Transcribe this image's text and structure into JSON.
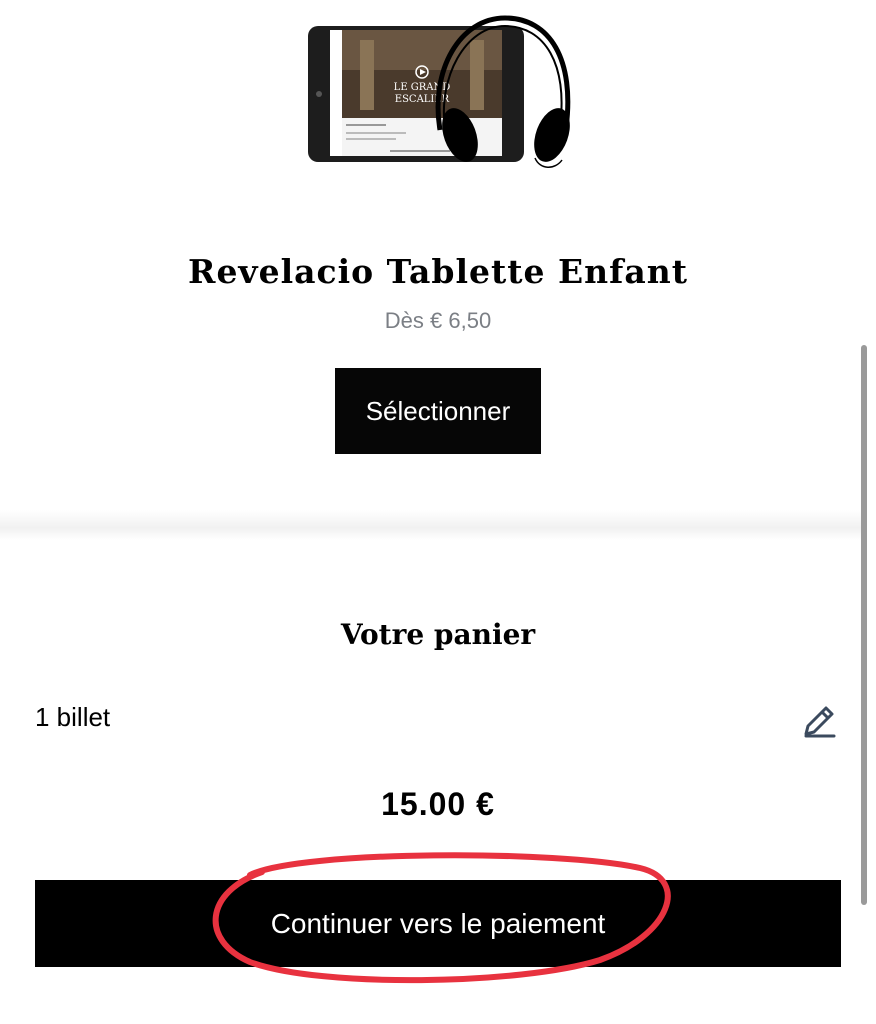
{
  "product": {
    "image_icon": "tablet-headphones-illustration",
    "screen_heading_line1": "LE GRAND",
    "screen_heading_line2": "ESCALIER",
    "title": "Revelacio Tablette Enfant",
    "price": "Dès € 6,50",
    "select_label": "Sélectionner"
  },
  "cart": {
    "title": "Votre panier",
    "count_label": "1 billet",
    "edit_icon": "pencil-icon",
    "total": "15.00 €",
    "checkout_label": "Continuer vers le paiement"
  },
  "colors": {
    "button_bg": "#000000",
    "price_text": "#7b7f85",
    "annotation_circle": "#e8323f",
    "edit_icon": "#3b4a5e"
  }
}
